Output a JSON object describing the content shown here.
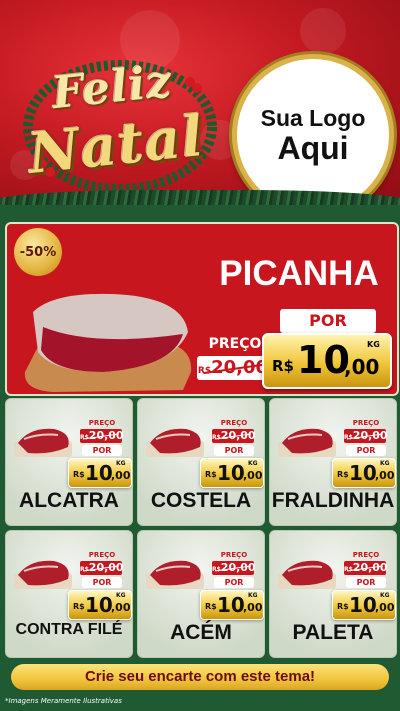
{
  "header": {
    "greeting_line1": "Feliz",
    "greeting_line2": "Natal",
    "logo_line1": "Sua Logo",
    "logo_line2": "Aqui"
  },
  "featured": {
    "discount": "-50%",
    "name": "PICANHA",
    "preco_label": "PREÇO",
    "old_currency": "R$",
    "old_price": "20,00",
    "por_label": "POR",
    "currency": "R$",
    "price_int": "10",
    "price_dec": ",00",
    "unit": "KG"
  },
  "products": [
    {
      "name": "ALCATRA",
      "preco_label": "PREÇO",
      "old_currency": "R$",
      "old_price": "20,00",
      "por_label": "POR",
      "currency": "R$",
      "price_int": "10",
      ",dec": "",
      "price_dec": ",00",
      "unit": "KG"
    },
    {
      "name": "COSTELA",
      "preco_label": "PREÇO",
      "old_currency": "R$",
      "old_price": "20,00",
      "por_label": "POR",
      "currency": "R$",
      "price_int": "10",
      "price_dec": ",00",
      "unit": "KG"
    },
    {
      "name": "FRALDINHA",
      "preco_label": "PREÇO",
      "old_currency": "R$",
      "old_price": "20,00",
      "por_label": "POR",
      "currency": "R$",
      "price_int": "10",
      "price_dec": ",00",
      "unit": "KG"
    },
    {
      "name": "CONTRA FILÉ",
      "preco_label": "PREÇO",
      "old_currency": "R$",
      "old_price": "20,00",
      "por_label": "POR",
      "currency": "R$",
      "price_int": "10",
      "price_dec": ",00",
      "unit": "KG"
    },
    {
      "name": "ACÉM",
      "preco_label": "PREÇO",
      "old_currency": "R$",
      "old_price": "20,00",
      "por_label": "POR",
      "currency": "R$",
      "price_int": "10",
      "price_dec": ",00",
      "unit": "KG"
    },
    {
      "name": "PALETA",
      "preco_label": "PREÇO",
      "old_currency": "R$",
      "old_price": "20,00",
      "por_label": "POR",
      "currency": "R$",
      "price_int": "10",
      "price_dec": ",00",
      "unit": "KG"
    }
  ],
  "footer": {
    "cta": "Crie seu encarte com este tema!",
    "disclaimer": "*Imagens Meramente Ilustrativas"
  },
  "colors": {
    "red": "#c8161f",
    "gold": "#f2c93a",
    "green": "#1f5a33"
  }
}
